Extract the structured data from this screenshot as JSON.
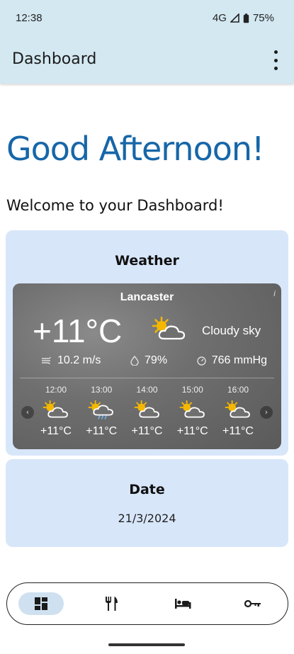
{
  "status": {
    "time": "12:38",
    "network": "4G",
    "battery": "75%"
  },
  "appbar": {
    "title": "Dashboard",
    "menu_icon": "more-vert-icon"
  },
  "main": {
    "greeting": "Good Afternoon!",
    "welcome": "Welcome to your Dashboard!"
  },
  "weather_card": {
    "title": "Weather",
    "city": "Lancaster",
    "temperature": "+11°C",
    "condition": "Cloudy sky",
    "wind": "10.2 m/s",
    "humidity": "79%",
    "pressure": "766 mmHg",
    "hourly": [
      {
        "time": "12:00",
        "icon": "partly-cloudy-icon",
        "temp": "+11°C"
      },
      {
        "time": "13:00",
        "icon": "rain-cloud-icon",
        "temp": "+11°C"
      },
      {
        "time": "14:00",
        "icon": "partly-cloudy-icon",
        "temp": "+11°C"
      },
      {
        "time": "15:00",
        "icon": "partly-cloudy-icon",
        "temp": "+11°C"
      },
      {
        "time": "16:00",
        "icon": "partly-cloudy-icon",
        "temp": "+11°C"
      }
    ]
  },
  "date_card": {
    "title": "Date",
    "value": "21/3/2024"
  },
  "navbar": {
    "items": [
      {
        "icon": "dashboard-icon",
        "active": true
      },
      {
        "icon": "restaurant-icon",
        "active": false
      },
      {
        "icon": "bed-icon",
        "active": false
      },
      {
        "icon": "key-icon",
        "active": false
      }
    ]
  },
  "colors": {
    "accent": "#1766a8",
    "header_bg": "#d3e8f1",
    "card_bg": "#d8e6fa",
    "nav_active": "#cfe1f0"
  }
}
